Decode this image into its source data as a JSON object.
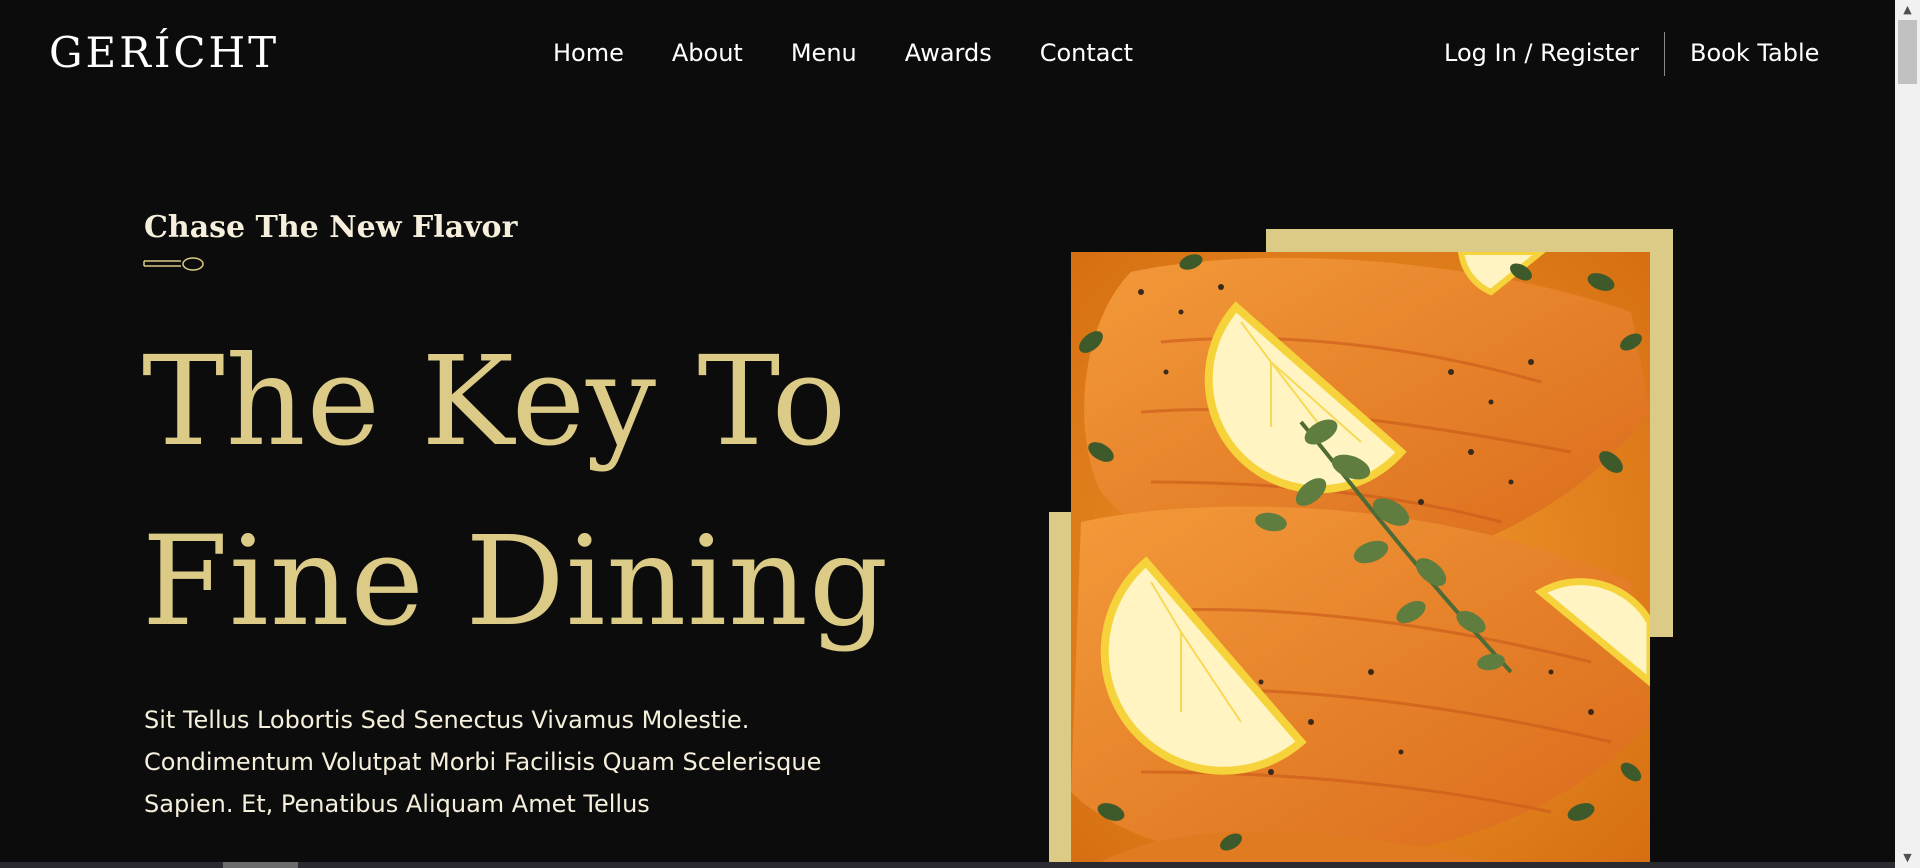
{
  "brand": {
    "logo": "GERÍCHT"
  },
  "nav": {
    "links": [
      "Home",
      "About",
      "Menu",
      "Awards",
      "Contact"
    ],
    "login": "Log In / Register",
    "book": "Book Table"
  },
  "hero": {
    "subtitle": "Chase The New Flavor",
    "headline_line1": "The Key To",
    "headline_line2": "Fine Dining",
    "description": "Sit Tellus Lobortis Sed Senectus Vivamus Molestie. Condimentum Volutpat Morbi Facilisis Quam Scelerisque Sapien. Et, Penatibus Aliquam Amet Tellus",
    "image_alt": "salmon-dish-photo"
  },
  "colors": {
    "background": "#0c0c0c",
    "gold": "#dcca87",
    "white": "#ffffff",
    "cream": "#f5efdb"
  },
  "icons": {
    "spoon": "spoon-icon",
    "scroll_up": "scroll-up-arrow",
    "scroll_down": "scroll-down-arrow"
  }
}
